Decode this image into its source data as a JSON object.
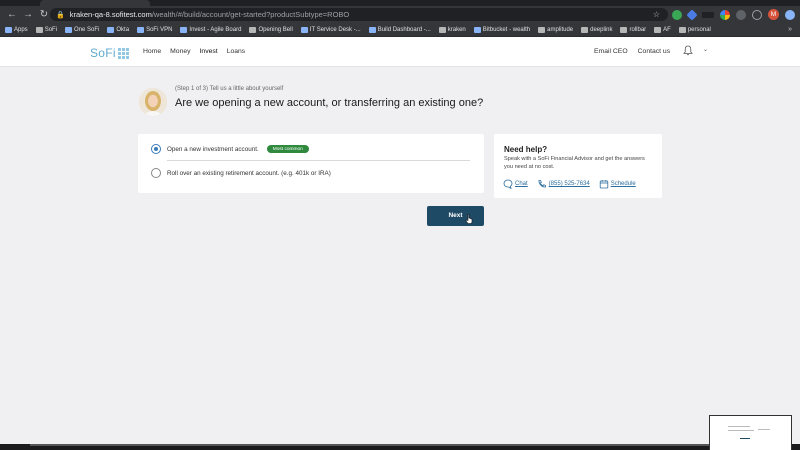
{
  "browser": {
    "url_host": "kraken-qa-8.sofitest.com",
    "url_path": "/wealth/#/build/account/get-started?productSubtype=ROBO",
    "profile_initial": "M",
    "bookmarks": [
      {
        "label": "Apps",
        "icon": "apps-grid-icon"
      },
      {
        "label": "SoFi",
        "icon": "folder-icon"
      },
      {
        "label": "One SoFi",
        "icon": "bookmark-icon"
      },
      {
        "label": "Okta",
        "icon": "bookmark-icon"
      },
      {
        "label": "SoFi VPN",
        "icon": "bookmark-icon"
      },
      {
        "label": "Invest - Agile Board",
        "icon": "bookmark-icon"
      },
      {
        "label": "Opening Bell",
        "icon": "folder-icon"
      },
      {
        "label": "IT Service Desk -...",
        "icon": "bookmark-icon"
      },
      {
        "label": "Build Dashboard -...",
        "icon": "bookmark-icon"
      },
      {
        "label": "kraken",
        "icon": "folder-icon"
      },
      {
        "label": "Bitbucket - wealth",
        "icon": "bookmark-icon"
      },
      {
        "label": "amplitude",
        "icon": "folder-icon"
      },
      {
        "label": "deeplink",
        "icon": "folder-icon"
      },
      {
        "label": "rollbar",
        "icon": "folder-icon"
      },
      {
        "label": "AF",
        "icon": "folder-icon"
      },
      {
        "label": "personal",
        "icon": "folder-icon"
      }
    ],
    "bookmarks_more": "»"
  },
  "header": {
    "logo_text": "SoFi",
    "nav": [
      "Home",
      "Money",
      "Invest",
      "Loans"
    ],
    "active_nav": "Invest",
    "right_links": [
      "Email CEO",
      "Contact us"
    ]
  },
  "step": {
    "label": "(Step 1 of 3) Tell us a little about yourself",
    "question": "Are we opening a new account, or transferring an existing one?"
  },
  "options": [
    {
      "label": "Open a new investment account.",
      "badge": "Most common",
      "selected": true
    },
    {
      "label": "Roll over an existing retirement account. (e.g. 401k or IRA)",
      "badge": "",
      "selected": false
    }
  ],
  "help": {
    "title": "Need help?",
    "description": "Speak with a SoFi Financial Advisor and get the answers you need at no cost.",
    "chat": "Chat",
    "phone": "(855) 525-7634",
    "schedule": "Schedule"
  },
  "next_button": "Next",
  "colors": {
    "primary_button": "#1f4a66",
    "radio_accent": "#3a7bb8",
    "badge_green": "#2f8a3e",
    "link_blue": "#2d6e9e",
    "logo_blue": "#5fa9cf",
    "page_bg": "#f0f0f2"
  }
}
